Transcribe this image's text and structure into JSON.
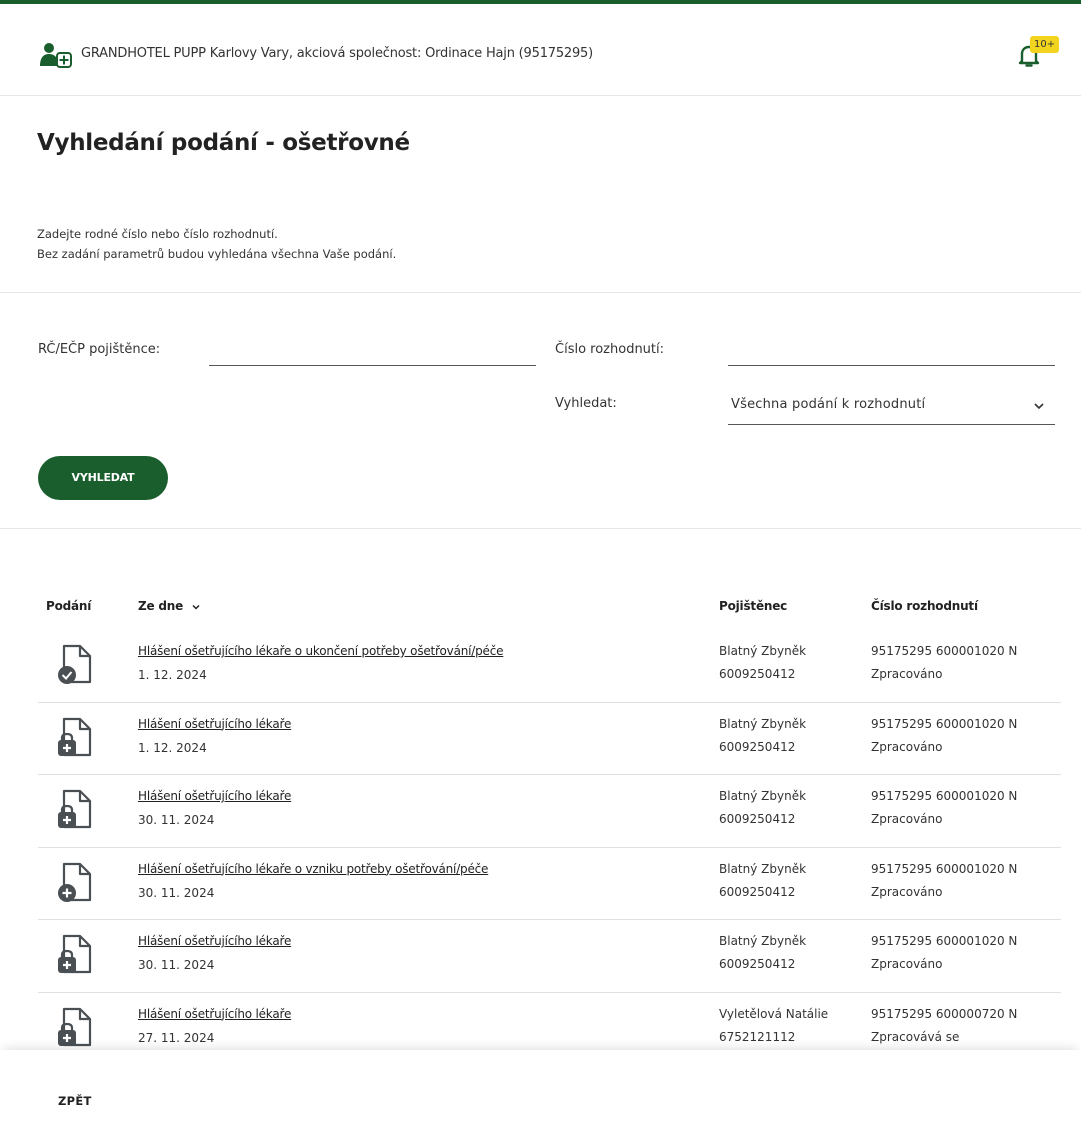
{
  "header": {
    "org_name": "GRANDHOTEL PUPP Karlovy Vary, akciová společnost: Ordinace Hajn (95175295)",
    "notification_badge": "10+",
    "brand_color": "#1b5e2e",
    "badge_color": "#f2d41f"
  },
  "page": {
    "title": "Vyhledání podání - ošetřovné",
    "intro_line1": "Zadejte rodné číslo nebo číslo rozhodnutí.",
    "intro_line2": "Bez zadání parametrů budou vyhledána všechna Vaše podání."
  },
  "form": {
    "rc_label": "RČ/EČP pojištěnce:",
    "rc_value": "",
    "decision_label": "Číslo rozhodnutí:",
    "decision_value": "",
    "search_label": "Vyhledat:",
    "search_selected": "Všechna podání k rozhodnutí",
    "submit_label": "VYHLEDAT"
  },
  "table": {
    "headers": {
      "podani": "Podání",
      "date": "Ze dne",
      "insured": "Pojištěnec",
      "decision": "Číslo rozhodnutí"
    },
    "rows": [
      {
        "icon": "document-check-icon",
        "name": "Hlášení ošetřujícího lékaře o ukončení potřeby ošetřování/péče",
        "date": "1. 12. 2024",
        "person": "Blatný Zbyněk",
        "rc": "6009250412",
        "decision": "95175295 600001020 N",
        "status": "Zpracováno"
      },
      {
        "icon": "document-medical-icon",
        "name": "Hlášení ošetřujícího lékaře",
        "date": "1. 12. 2024",
        "person": "Blatný Zbyněk",
        "rc": "6009250412",
        "decision": "95175295 600001020 N",
        "status": "Zpracováno"
      },
      {
        "icon": "document-medical-icon",
        "name": "Hlášení ošetřujícího lékaře",
        "date": "30. 11. 2024",
        "person": "Blatný Zbyněk",
        "rc": "6009250412",
        "decision": "95175295 600001020 N",
        "status": "Zpracováno"
      },
      {
        "icon": "document-add-icon",
        "name": "Hlášení ošetřujícího lékaře o vzniku potřeby ošetřování/péče",
        "date": "30. 11. 2024",
        "person": "Blatný Zbyněk",
        "rc": "6009250412",
        "decision": "95175295 600001020 N",
        "status": "Zpracováno"
      },
      {
        "icon": "document-medical-icon",
        "name": "Hlášení ošetřujícího lékaře",
        "date": "30. 11. 2024",
        "person": "Blatný Zbyněk",
        "rc": "6009250412",
        "decision": "95175295 600001020 N",
        "status": "Zpracováno"
      },
      {
        "icon": "document-medical-icon",
        "name": "Hlášení ošetřujícího lékaře",
        "date": "27. 11. 2024",
        "person": "Vyletělová Natálie",
        "rc": "6752121112",
        "decision": "95175295 600000720 N",
        "status": "Zpracovává se"
      }
    ]
  },
  "footer": {
    "back_label": "ZPĚT"
  }
}
